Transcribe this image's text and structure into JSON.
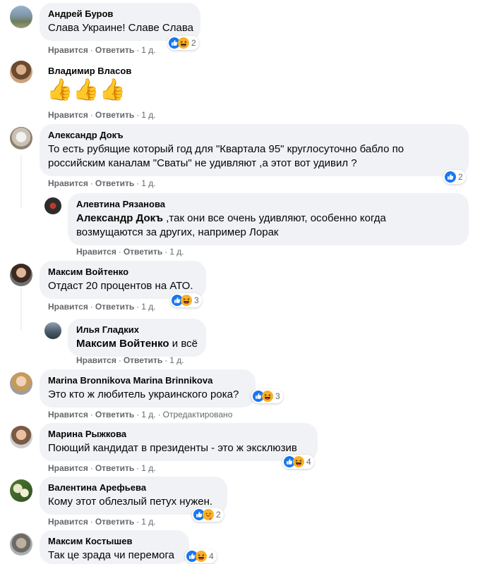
{
  "actions": {
    "like": "Нравится",
    "reply": "Ответить",
    "time": "1 д.",
    "edited": "Отредактировано"
  },
  "comments": [
    {
      "author": "Андрей Буров",
      "text": "Слава Украине! Славе Слава",
      "reactions": "2"
    },
    {
      "author": "Владимир Власов",
      "text": "👍👍👍"
    },
    {
      "author": "Александр Докъ",
      "text_line1": "То есть рубящие который год для \"Квартала 95\" круглосуточно бабло по",
      "text_line2": "российским каналам \"Сваты\" не удивляют ,а этот вот удивил ?",
      "reactions": "2"
    },
    {
      "author": "Алевтина Рязанова",
      "mention": "Александр Докъ",
      "text_line1": " ,так они все очень удивляют, особенно когда",
      "text_line2": "возмущаются за других, например Лорак"
    },
    {
      "author": "Максим Войтенко",
      "text": "Отдаст 20 процентов на АТО.",
      "reactions": "3"
    },
    {
      "author": "Илья Гладких",
      "mention": "Максим Войтенко",
      "text": " и всё"
    },
    {
      "author": "Marina Bronnikova Marina Brinnikova",
      "text": "Это кто ж любитель украинского рока?",
      "reactions": "3"
    },
    {
      "author": "Марина Рыжкова",
      "text": "Поющий кандидат в президенты - это ж эксклюзив",
      "reactions": "4"
    },
    {
      "author": "Валентина Арефьева",
      "text": "Кому этот облезлый петух нужен.",
      "reactions": "2"
    },
    {
      "author": "Максим Костышев",
      "text": "Так це зрада чи перемога",
      "reactions": "4"
    }
  ]
}
